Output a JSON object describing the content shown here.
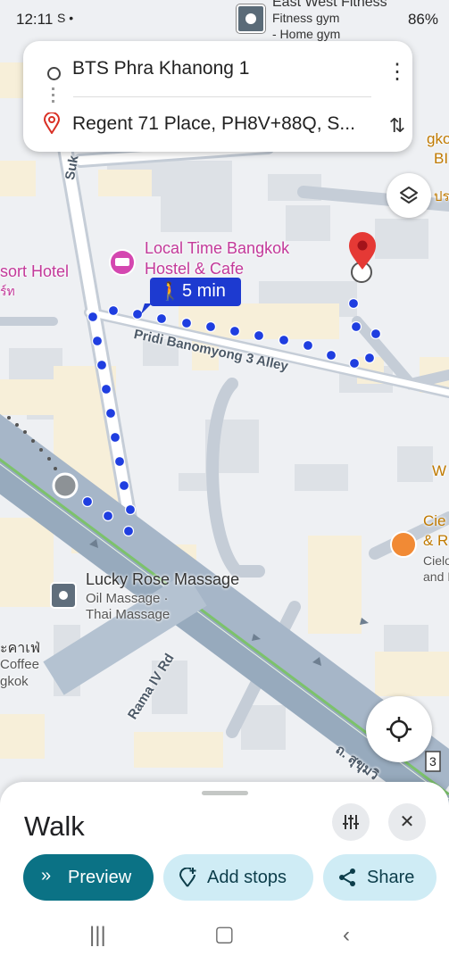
{
  "status_bar": {
    "time": "12:11",
    "left_icons": "S •",
    "right_text": "86%",
    "notification_title": "East West Fitness",
    "notification_line2": "Fitness gym",
    "notification_line3": "- Home gym"
  },
  "directions": {
    "origin": "BTS Phra Khanong 1",
    "destination": "Regent 71 Place, PH8V+88Q, S...",
    "more_icon": "more-vert-icon",
    "swap_icon": "swap-vertical-icon"
  },
  "route": {
    "duration": "5 min",
    "mode_icon": "walk-icon",
    "color": "#1f3ee0"
  },
  "map_labels": {
    "hostel_line1": "Local Time Bangkok",
    "hostel_line2": "Hostel & Cafe",
    "hotel_partial": "sort Hotel",
    "hotel_thai": "ร์ท",
    "street_pridi": "Pridi Banomyong 3 Alley",
    "street_rama": "Rama IV Rd",
    "street_suk": "Suk",
    "massage_title": "Lucky Rose Massage",
    "massage_line2": "Oil Massage ·",
    "massage_line3": "Thai Massage",
    "cafe_thai": "ะคาเฟ่",
    "cafe_line2": "Coffee",
    "cafe_line3": "gkok",
    "right_partial_1": "gko",
    "right_partial_2": "BI",
    "right_partial_3": "ปร",
    "right_partial_w": "W",
    "cielo_1": "Cie",
    "cielo_2": "& R",
    "cielo_3": "Cielo",
    "cielo_4": "and I",
    "road_sign": "3",
    "thai_road": "ถ. สุขุมวิ"
  },
  "bottom_sheet": {
    "title": "Walk",
    "filter_icon": "tune-icon",
    "close_icon": "close-icon",
    "preview_label": "Preview",
    "add_stops_label": "Add stops",
    "share_label": "Share"
  },
  "colors": {
    "accent": "#0b7285",
    "pill_light": "#cfecf5",
    "marker_red": "#e53935",
    "poi_pink": "#c3399a"
  }
}
